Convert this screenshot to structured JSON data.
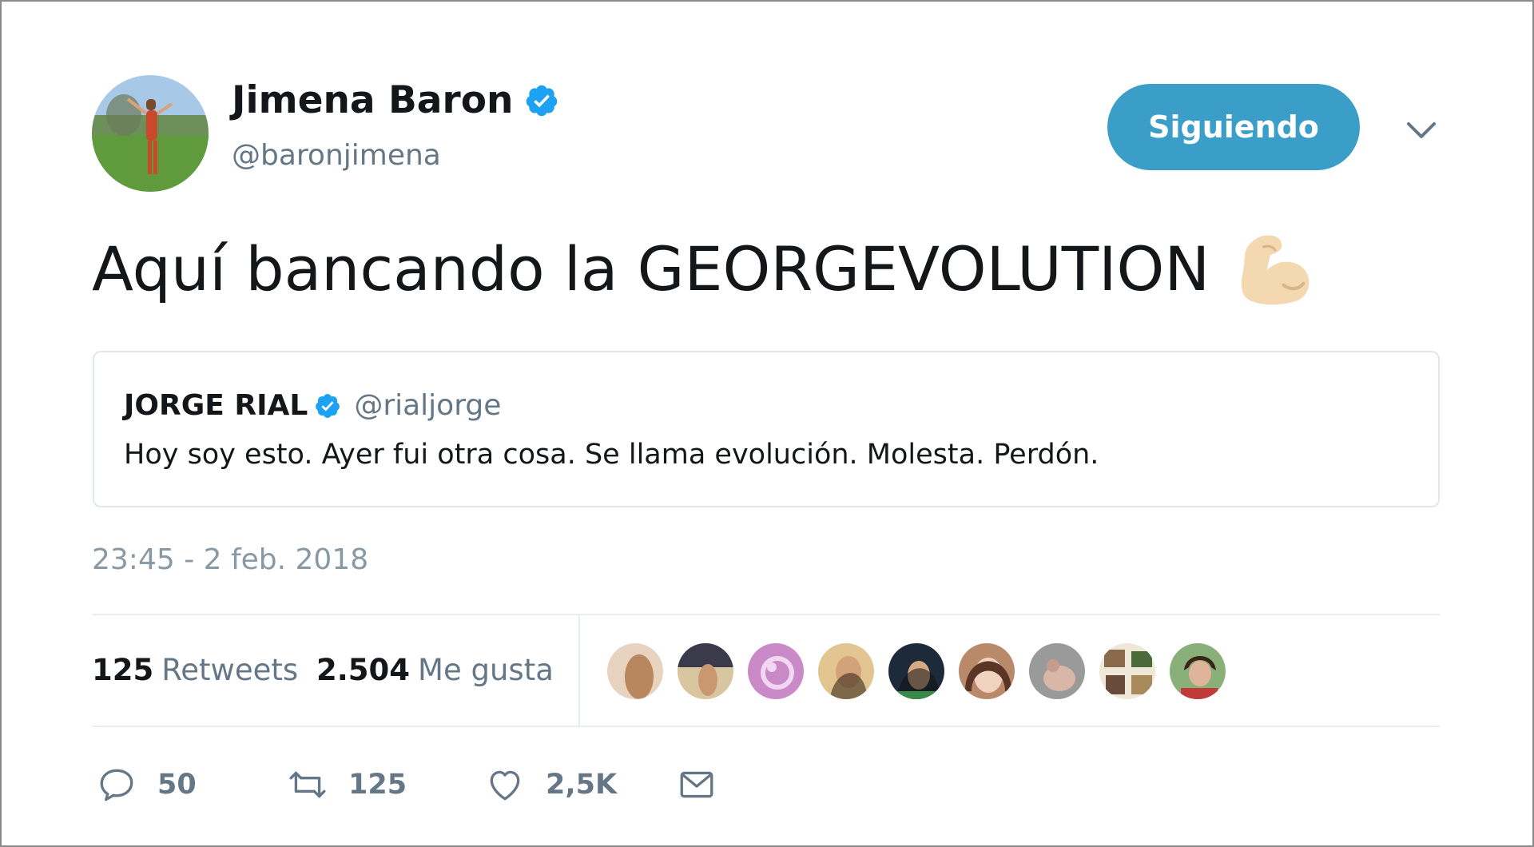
{
  "tweet": {
    "author": {
      "name": "Jimena Baron",
      "handle": "@baronjimena",
      "verified": true
    },
    "follow_button_label": "Siguiendo",
    "text": "Aquí bancando la GEORGEVOLUTION",
    "emoji": "flexed-biceps",
    "quoted": {
      "name": "JORGE RIAL",
      "handle": "@rialjorge",
      "verified": true,
      "text": "Hoy soy esto. Ayer fui otra cosa. Se llama evolución. Molesta. Perdón."
    },
    "timestamp": "23:45 - 2 feb. 2018",
    "stats": {
      "retweets_count": "125",
      "retweets_label": "Retweets",
      "likes_count": "2.504",
      "likes_label": "Me gusta"
    },
    "actions": {
      "reply_count": "50",
      "retweet_count": "125",
      "like_count": "2,5K"
    }
  },
  "colors": {
    "accent": "#3a9ec9",
    "verified": "#1da1f2",
    "muted_text": "#657786",
    "timestamp_text": "#8899a6"
  }
}
